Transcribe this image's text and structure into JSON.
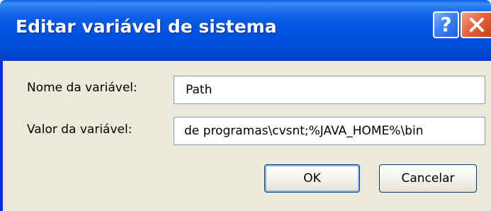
{
  "window": {
    "title": "Editar variável de sistema"
  },
  "titlebar_buttons": {
    "help_label": "?",
    "close_label": "Close"
  },
  "form": {
    "name_label": "Nome da variável:",
    "name_value": "Path",
    "value_label": "Valor da variável:",
    "value_value": "de programas\\cvsnt;%JAVA_HOME%\\bin"
  },
  "buttons": {
    "ok_label": "OK",
    "cancel_label": "Cancelar"
  },
  "icons": {
    "help": "help-icon",
    "close": "close-icon"
  },
  "colors": {
    "titlebar": "#0054e3",
    "close_button": "#e5653e",
    "dialog_face": "#ece9d8"
  }
}
